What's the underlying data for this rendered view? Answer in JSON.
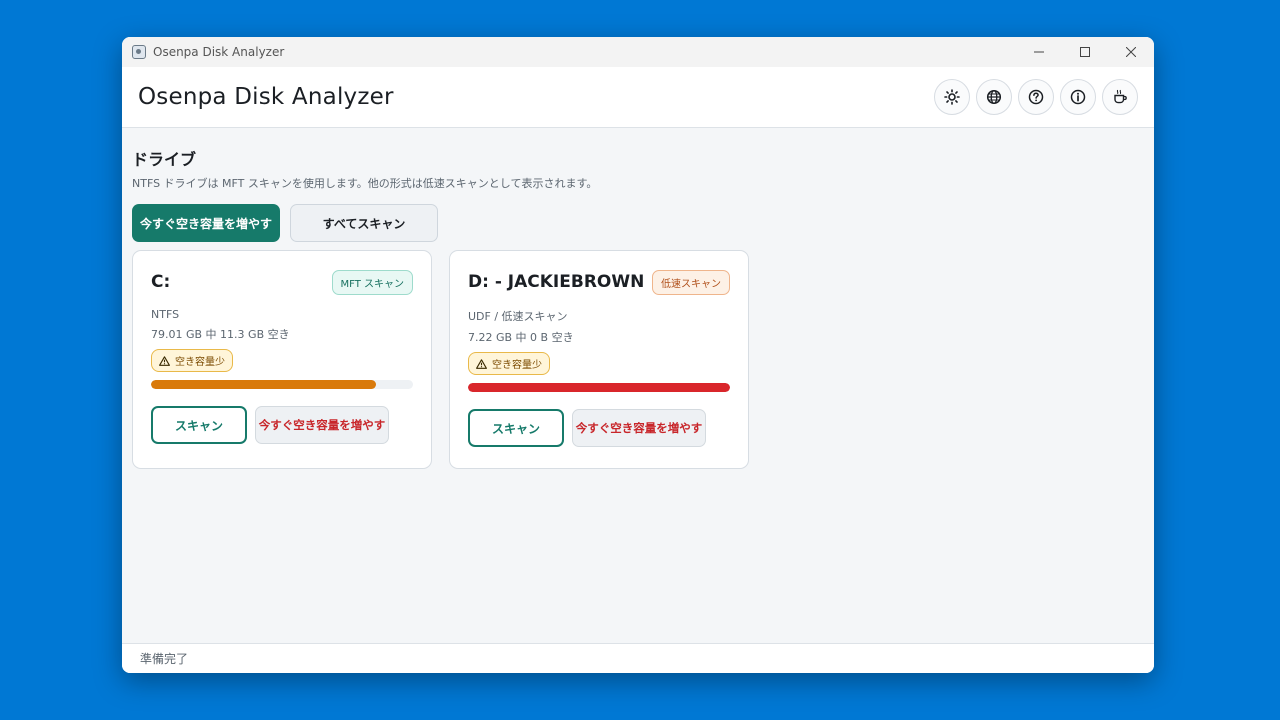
{
  "window": {
    "title": "Osenpa Disk Analyzer",
    "controls": {
      "minimize": "minimize-icon",
      "maximize": "maximize-icon",
      "close": "close-icon"
    }
  },
  "header": {
    "title": "Osenpa Disk Analyzer",
    "tools": [
      {
        "name": "theme-toggle",
        "icon": "sun-icon"
      },
      {
        "name": "language",
        "icon": "globe-icon"
      },
      {
        "name": "help",
        "icon": "question-icon"
      },
      {
        "name": "about",
        "icon": "info-icon"
      },
      {
        "name": "donate",
        "icon": "coffee-icon"
      }
    ]
  },
  "drives_section": {
    "title": "ドライブ",
    "description": "NTFS ドライブは MFT スキャンを使用します。他の形式は低速スキャンとして表示されます。",
    "free_space_label": "今すぐ空き容量を増やす",
    "scan_all_label": "すべてスキャン"
  },
  "drives": [
    {
      "name": "C:",
      "badge": "MFT スキャン",
      "filesystem": "NTFS",
      "capacity": "79.01 GB 中 11.3 GB 空き",
      "warning": "空き容量少",
      "used_fraction": 0.857,
      "bar_color": "#d97a0b",
      "scan_label": "スキャン",
      "free_label": "今すぐ空き容量を増やす"
    },
    {
      "name": "D: - JACKIEBROWN",
      "badge": "低速スキャン",
      "filesystem": "UDF / 低速スキャン",
      "capacity": "7.22 GB 中 0 B 空き",
      "warning": "空き容量少",
      "used_fraction": 1.0,
      "bar_color": "#d9262b",
      "scan_label": "スキャン",
      "free_label": "今すぐ空き容量を増やす"
    }
  ],
  "status": {
    "text": "準備完了"
  },
  "colors": {
    "accent": "#167a6a",
    "desktop": "#0078d4",
    "danger": "#c8262a",
    "warning": "#d97a0b"
  }
}
